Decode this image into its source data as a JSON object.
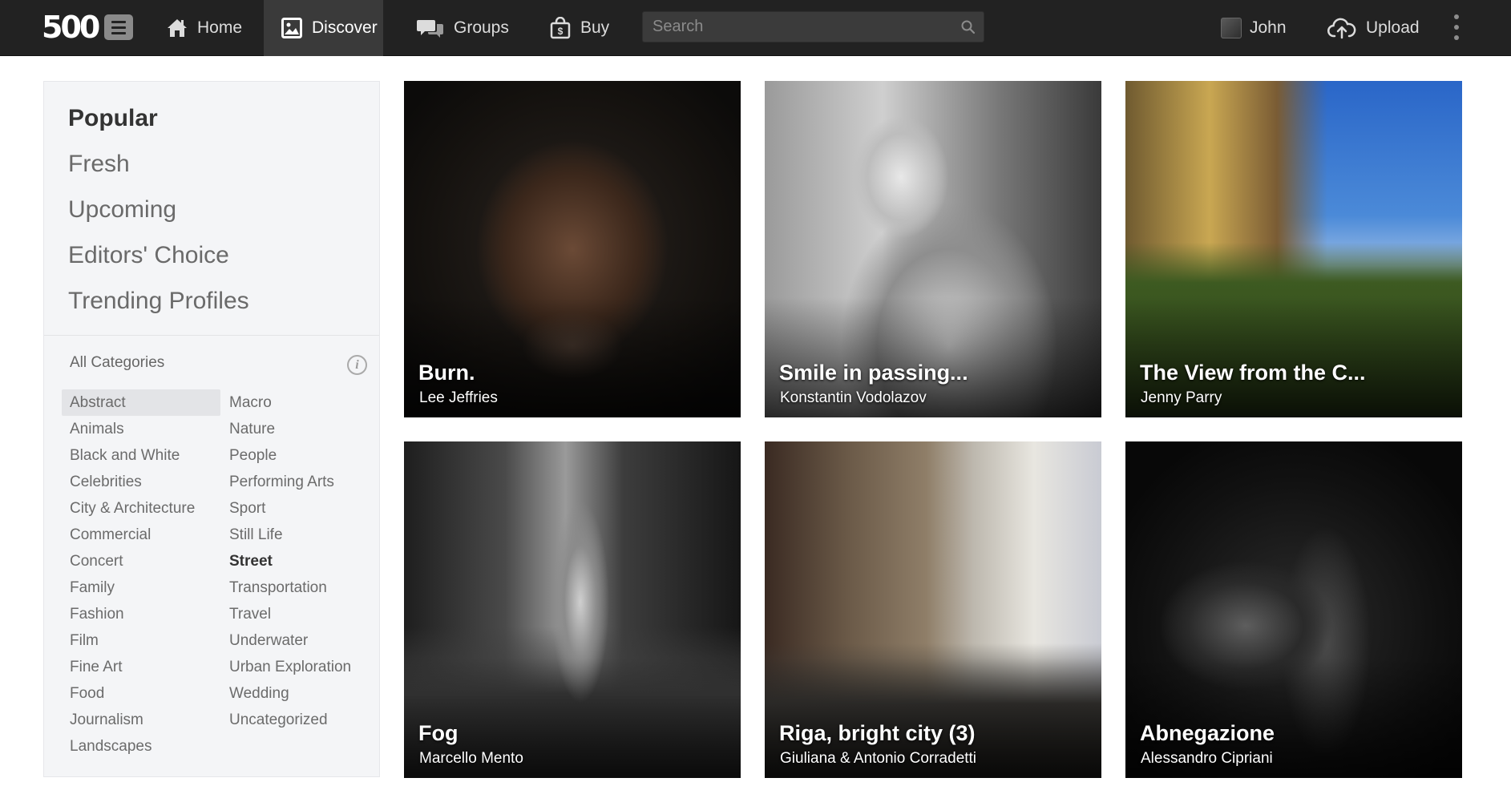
{
  "topbar": {
    "logo_text": "500",
    "nav": [
      {
        "label": "Home",
        "icon": "home-icon"
      },
      {
        "label": "Discover",
        "icon": "image-icon",
        "active": true
      },
      {
        "label": "Groups",
        "icon": "chat-bubbles-icon"
      },
      {
        "label": "Buy",
        "icon": "shopping-bag-icon"
      }
    ],
    "search": {
      "placeholder": "Search",
      "value": ""
    },
    "user": {
      "name": "John",
      "icon": "avatar"
    },
    "upload_label": "Upload"
  },
  "sidebar": {
    "feeds": [
      {
        "label": "Popular",
        "active": true
      },
      {
        "label": "Fresh"
      },
      {
        "label": "Upcoming"
      },
      {
        "label": "Editors' Choice"
      },
      {
        "label": "Trending Profiles"
      }
    ],
    "categories_header": "All Categories",
    "categories_left": [
      "Abstract",
      "Animals",
      "Black and White",
      "Celebrities",
      "City & Architecture",
      "Commercial",
      "Concert",
      "Family",
      "Fashion",
      "Film",
      "Fine Art",
      "Food",
      "Journalism",
      "Landscapes"
    ],
    "categories_right": [
      "Macro",
      "Nature",
      "People",
      "Performing Arts",
      "Sport",
      "Still Life",
      "Street",
      "Transportation",
      "Travel",
      "Underwater",
      "Urban Exploration",
      "Wedding",
      "Uncategorized"
    ],
    "highlighted_category": "Abstract",
    "selected_category": "Street"
  },
  "photos": [
    {
      "title": "Burn.",
      "author": "Lee Jeffries"
    },
    {
      "title": "Smile in passing...",
      "author": "Konstantin Vodolazov"
    },
    {
      "title": "The View from the C...",
      "author": "Jenny Parry"
    },
    {
      "title": "Fog",
      "author": "Marcello Mento"
    },
    {
      "title": "Riga, bright city (3)",
      "author": "Giuliana & Antonio Corradetti"
    },
    {
      "title": "Abnegazione",
      "author": "Alessandro Cipriani"
    }
  ],
  "colors": {
    "topbar_bg": "#222222",
    "active_nav_bg": "#3a3a3a",
    "sidebar_bg": "#f4f5f7"
  }
}
